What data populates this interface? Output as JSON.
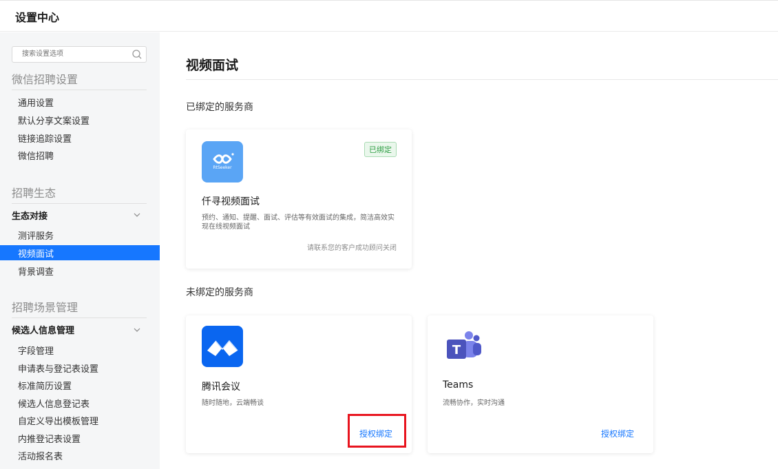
{
  "app": {
    "title": "设置中心"
  },
  "sidebar": {
    "search_placeholder": "搜索设置选项",
    "sections": [
      {
        "title": "微信招聘设置",
        "items": [
          "通用设置",
          "默认分享文案设置",
          "链接追踪设置",
          "微信招聘"
        ]
      },
      {
        "title": "招聘生态",
        "group": "生态对接",
        "items": [
          "测评服务",
          "视频面试",
          "背景调查"
        ]
      },
      {
        "title": "招聘场景管理",
        "group": "候选人信息管理",
        "items": [
          "字段管理",
          "申请表与登记表设置",
          "标准简历设置",
          "候选人信息登记表",
          "自定义导出模板管理",
          "内推登记表设置",
          "活动报名表"
        ]
      }
    ],
    "active_item": "视频面试"
  },
  "main": {
    "title": "视频面试",
    "bound_label": "已绑定的服务商",
    "unbound_label": "未绑定的服务商",
    "bound_cards": [
      {
        "name": "仟寻视频面试",
        "logo_text": "RtSeeker",
        "badge": "已绑定",
        "desc": "预约、通知、提醒、面试、评估等有效面试的集成，简洁高效实现在线视频面试",
        "note": "请联系您的客户成功顾问关闭"
      }
    ],
    "unbound_cards": [
      {
        "name": "腾讯会议",
        "desc": "随时随地，云端畅谈",
        "action": "授权绑定"
      },
      {
        "name": "Teams",
        "desc": "流畅协作，实时沟通",
        "action": "授权绑定"
      }
    ]
  },
  "colors": {
    "accent": "#1677ff",
    "bound_badge": "#2f9e44",
    "highlight": "#e8141e"
  },
  "icons": {
    "search": "search-icon",
    "chevron": "chevron-down-icon"
  }
}
